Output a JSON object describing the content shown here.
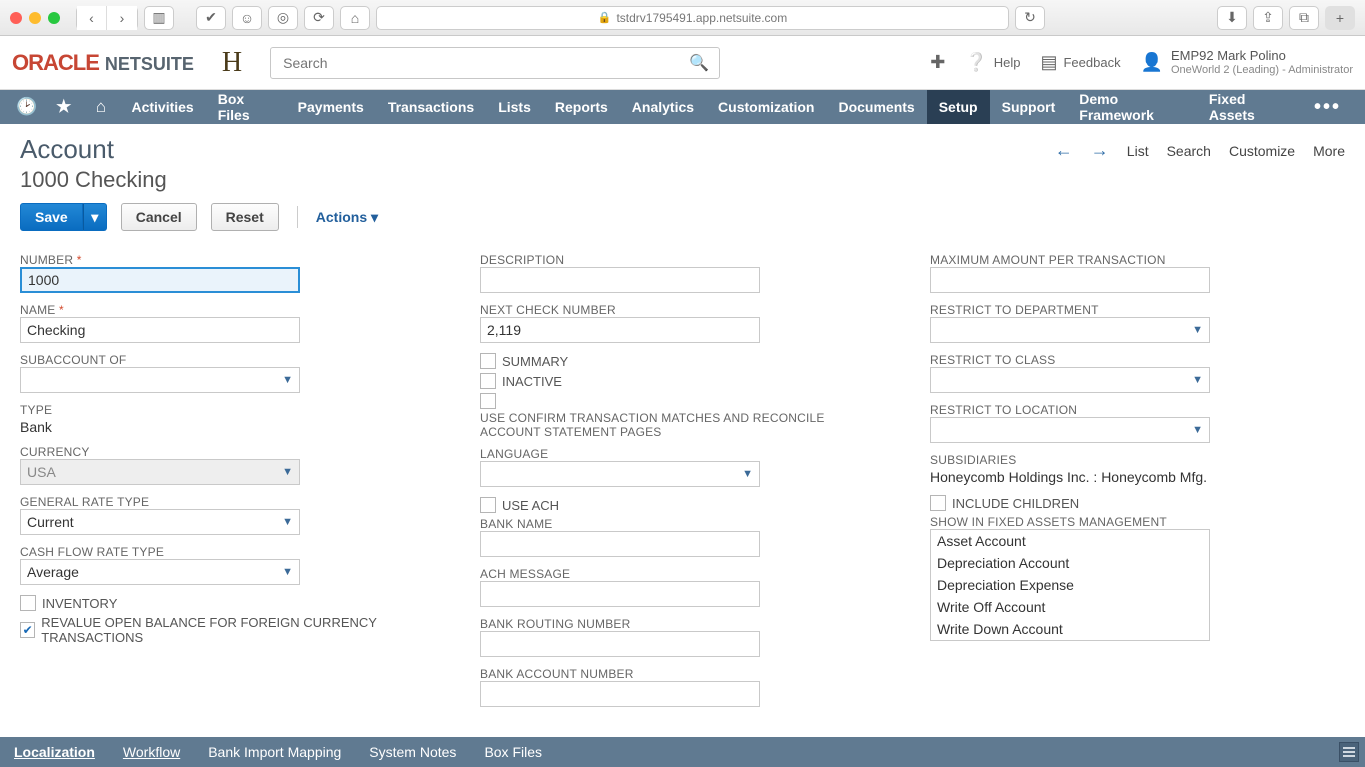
{
  "browser": {
    "url": "tstdrv1795491.app.netsuite.com"
  },
  "header": {
    "logo_oracle": "ORACLE",
    "logo_ns": "NETSUITE",
    "company_glyph": "H",
    "search_placeholder": "Search",
    "help": "Help",
    "feedback": "Feedback",
    "user_name": "EMP92 Mark Polino",
    "user_role": "OneWorld 2 (Leading) - Administrator"
  },
  "nav": [
    "Activities",
    "Box Files",
    "Payments",
    "Transactions",
    "Lists",
    "Reports",
    "Analytics",
    "Customization",
    "Documents",
    "Setup",
    "Support",
    "Demo Framework",
    "Fixed Assets"
  ],
  "nav_active": "Setup",
  "page": {
    "title": "Account",
    "subtitle": "1000 Checking",
    "right_links": [
      "List",
      "Search",
      "Customize",
      "More"
    ]
  },
  "buttons": {
    "save": "Save",
    "cancel": "Cancel",
    "reset": "Reset",
    "actions": "Actions"
  },
  "col1": {
    "number_label": "NUMBER",
    "number_value": "1000",
    "name_label": "NAME",
    "name_value": "Checking",
    "subaccount_label": "SUBACCOUNT OF",
    "subaccount_value": "",
    "type_label": "TYPE",
    "type_value": "Bank",
    "currency_label": "CURRENCY",
    "currency_value": "USA",
    "general_rate_label": "GENERAL RATE TYPE",
    "general_rate_value": "Current",
    "cashflow_rate_label": "CASH FLOW RATE TYPE",
    "cashflow_rate_value": "Average",
    "inventory_label": "INVENTORY",
    "revalue_label": "REVALUE OPEN BALANCE FOR FOREIGN CURRENCY TRANSACTIONS"
  },
  "col2": {
    "description_label": "DESCRIPTION",
    "nextcheck_label": "NEXT CHECK NUMBER",
    "nextcheck_value": "2,119",
    "summary_label": "SUMMARY",
    "inactive_label": "INACTIVE",
    "useconfirm_label": "USE CONFIRM TRANSACTION MATCHES AND RECONCILE ACCOUNT STATEMENT PAGES",
    "language_label": "LANGUAGE",
    "useach_label": "USE ACH",
    "bankname_label": "BANK NAME",
    "achmsg_label": "ACH MESSAGE",
    "routing_label": "BANK ROUTING NUMBER",
    "acctnum_label": "BANK ACCOUNT NUMBER"
  },
  "col3": {
    "maxamt_label": "MAXIMUM AMOUNT PER TRANSACTION",
    "rdept_label": "RESTRICT TO DEPARTMENT",
    "rclass_label": "RESTRICT TO CLASS",
    "rloc_label": "RESTRICT TO LOCATION",
    "subs_label": "SUBSIDIARIES",
    "subs_value": "Honeycomb Holdings Inc. : Honeycomb Mfg.",
    "include_children_label": "INCLUDE CHILDREN",
    "showfa_label": "SHOW IN FIXED ASSETS MANAGEMENT",
    "fa_options": [
      "Asset Account",
      "Depreciation Account",
      "Depreciation Expense",
      "Write Off Account",
      "Write Down Account"
    ]
  },
  "subtabs": [
    "Localization",
    "Workflow",
    "Bank Import Mapping",
    "System Notes",
    "Box Files"
  ]
}
